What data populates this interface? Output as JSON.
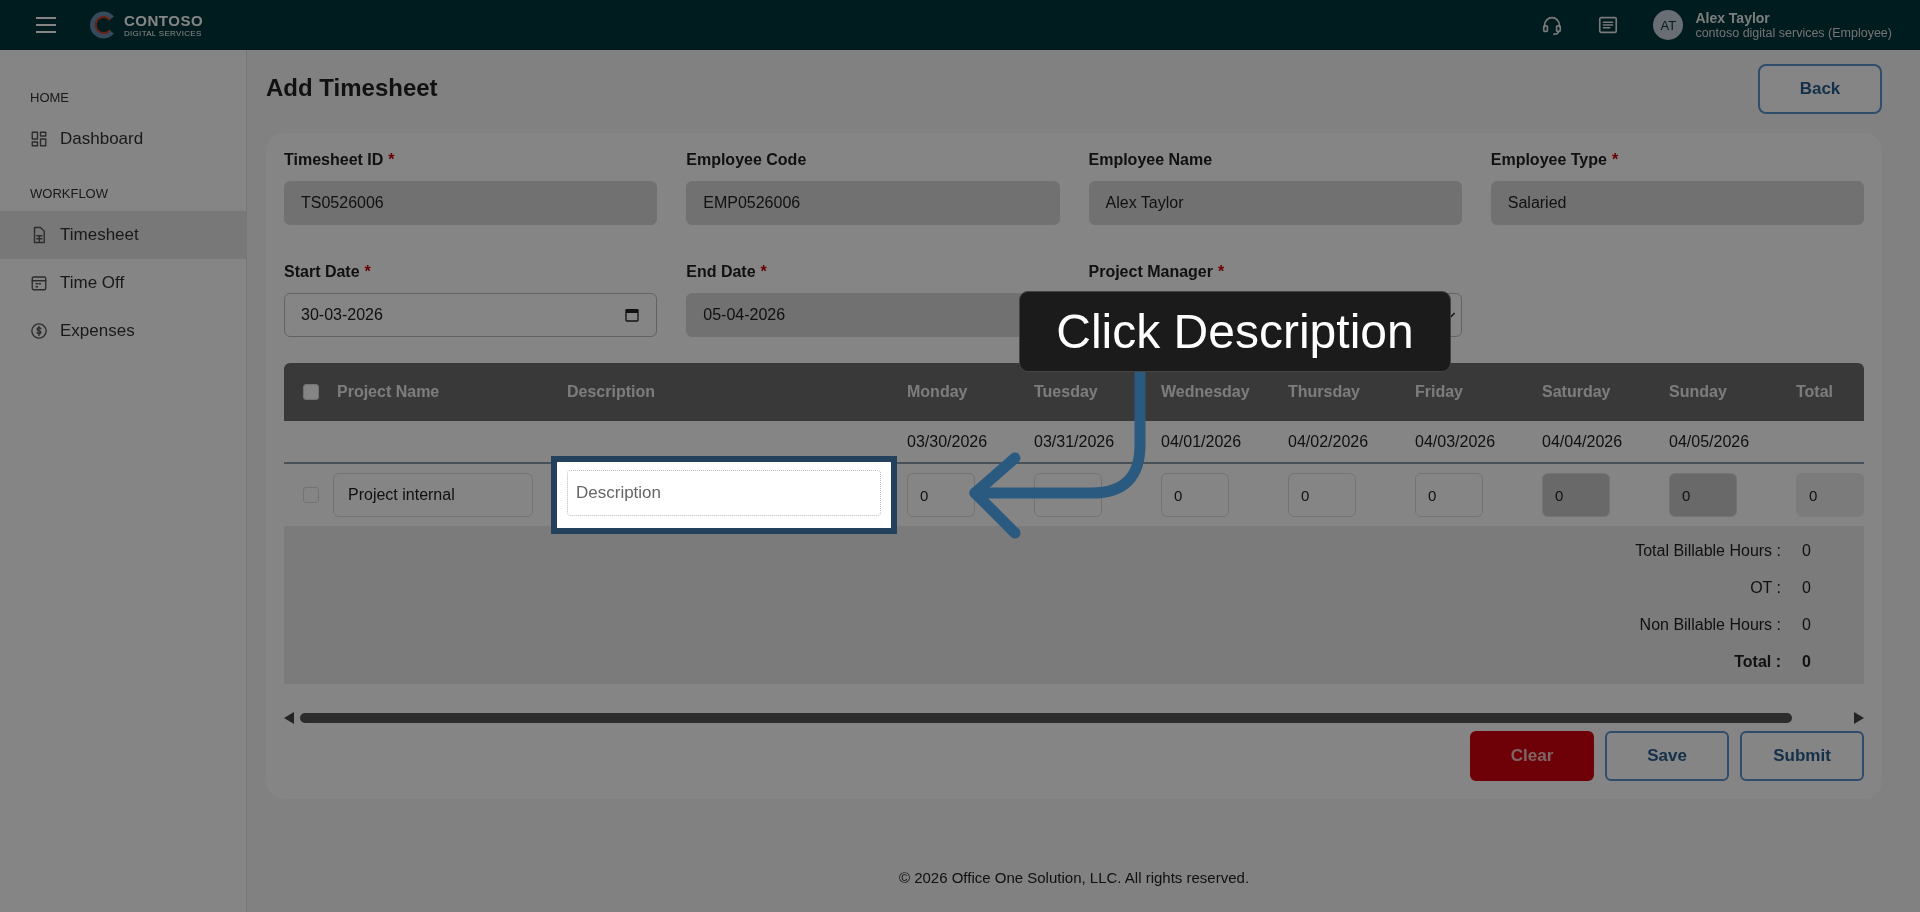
{
  "header": {
    "logo": {
      "name": "CONTOSO",
      "tagline": "DIGITAL SERVICES"
    },
    "user": {
      "initials": "AT",
      "name": "Alex Taylor",
      "org": "contoso digital services (Employee)"
    }
  },
  "sidebar": {
    "sections": [
      {
        "heading": "HOME",
        "items": [
          {
            "label": "Dashboard",
            "selected": false
          }
        ]
      },
      {
        "heading": "WORKFLOW",
        "items": [
          {
            "label": "Timesheet",
            "selected": true
          },
          {
            "label": "Time Off",
            "selected": false
          },
          {
            "label": "Expenses",
            "selected": false
          }
        ]
      }
    ]
  },
  "page": {
    "title": "Add Timesheet",
    "back_button": "Back"
  },
  "form": {
    "fields": [
      {
        "label": "Timesheet ID",
        "required_mark": "*",
        "value": "TS0526006",
        "kind": "text",
        "disabled": true
      },
      {
        "label": "Employee Code",
        "value": "EMP0526006",
        "kind": "text",
        "disabled": true
      },
      {
        "label": "Employee Name",
        "value": "Alex Taylor",
        "kind": "text",
        "disabled": true
      },
      {
        "label": "Employee Type",
        "required_mark": "*",
        "value": "Salaried",
        "kind": "text",
        "disabled": true
      },
      {
        "label": "Start Date",
        "required_mark": "*",
        "value": "30-03-2026",
        "kind": "date",
        "disabled": false
      },
      {
        "label": "End Date",
        "required_mark": "*",
        "value": "05-04-2026",
        "kind": "text",
        "disabled": true
      },
      {
        "label": "Project Manager",
        "required_mark": "*",
        "kind": "select",
        "disabled": false
      }
    ]
  },
  "table": {
    "select_all": {
      "checked": false
    },
    "columns": [
      {
        "label": "Project Name",
        "kind": "project"
      },
      {
        "label": "Description",
        "kind": "description"
      },
      {
        "label": "Monday",
        "kind": "day",
        "date": "03/30/2026"
      },
      {
        "label": "Tuesday",
        "kind": "day",
        "date": "03/31/2026"
      },
      {
        "label": "Wednesday",
        "kind": "day",
        "date": "04/01/2026"
      },
      {
        "label": "Thursday",
        "kind": "day",
        "date": "04/02/2026"
      },
      {
        "label": "Friday",
        "kind": "day",
        "date": "04/03/2026"
      },
      {
        "label": "Saturday",
        "kind": "day",
        "date": "04/04/2026"
      },
      {
        "label": "Sunday",
        "kind": "day",
        "date": "04/05/2026"
      },
      {
        "label": "Total",
        "kind": "total"
      }
    ],
    "rows": [
      {
        "selected": false,
        "project": "Project internal",
        "description_placeholder": "Description",
        "hours": [
          {
            "value": "0",
            "disabled": false
          },
          {
            "disabled": false
          },
          {
            "value": "0",
            "disabled": false
          },
          {
            "value": "0",
            "disabled": false
          },
          {
            "value": "0",
            "disabled": false
          },
          {
            "value": "0",
            "disabled": true
          },
          {
            "value": "0",
            "disabled": true
          }
        ],
        "total": "0"
      }
    ],
    "totals": [
      {
        "label": "Total Billable Hours :",
        "value": "0",
        "bold": false
      },
      {
        "label": "OT :",
        "value": "0",
        "bold": false
      },
      {
        "label": "Non Billable Hours :",
        "value": "0",
        "bold": false
      },
      {
        "label": "Total :",
        "value": "0",
        "bold": true
      }
    ]
  },
  "buttons": [
    {
      "label": "Clear",
      "kind": "danger"
    },
    {
      "label": "Save",
      "kind": "outline"
    },
    {
      "label": "Submit",
      "kind": "outline"
    }
  ],
  "footer": "© 2026 Office One Solution, LLC. All rights reserved.",
  "tour": {
    "callout": "Click Description"
  }
}
